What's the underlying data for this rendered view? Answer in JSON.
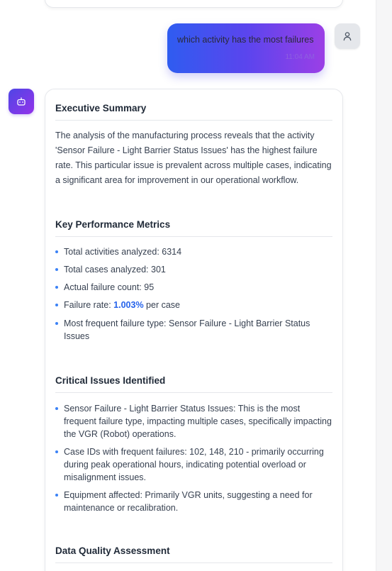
{
  "user_message": {
    "text": "which activity has the most failures",
    "time": "11:04 AM"
  },
  "icons": {
    "user_avatar": "user-icon",
    "bot_avatar": "bot-icon"
  },
  "colors": {
    "accent_blue": "#2f5cf0",
    "accent_purple": "#9b3fe6",
    "bullet": "#3b82f6",
    "highlight": "#2563eb"
  },
  "response": {
    "executive_summary": {
      "title": "Executive Summary",
      "body": "The analysis of the manufacturing process reveals that the activity 'Sensor Failure - Light Barrier Status Issues' has the highest failure rate. This particular issue is prevalent across multiple cases, indicating a significant area for improvement in our operational workflow."
    },
    "key_metrics": {
      "title": "Key Performance Metrics",
      "items": [
        "Total activities analyzed: 6314",
        "Total cases analyzed: 301",
        "Actual failure count: 95"
      ],
      "failure_rate": {
        "prefix": "Failure rate: ",
        "value": "1.003%",
        "suffix": " per case"
      },
      "last_item": "Most frequent failure type: Sensor Failure - Light Barrier Status Issues"
    },
    "critical_issues": {
      "title": "Critical Issues Identified",
      "items": [
        "Sensor Failure - Light Barrier Status Issues: This is the most frequent failure type, impacting multiple cases, specifically impacting the VGR (Robot) operations.",
        "Case IDs with frequent failures: 102, 148, 210 - primarily occurring during peak operational hours, indicating potential overload or misalignment issues.",
        "Equipment affected: Primarily VGR units, suggesting a need for maintenance or recalibration."
      ]
    },
    "data_quality": {
      "title": "Data Quality Assessment"
    }
  }
}
